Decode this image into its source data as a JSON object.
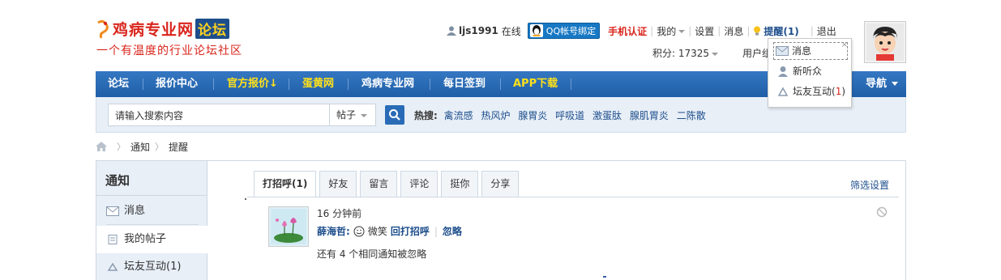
{
  "logo": {
    "title": "鸡病专业网",
    "badge": "论坛",
    "slogan": "一个有温度的行业论坛社区"
  },
  "topbar": {
    "username": "ljs1991",
    "online": "在线",
    "qq_bind": "QQ帐号绑定",
    "phone_verify": "手机认证",
    "mine": "我的",
    "settings": "设置",
    "messages": "消息",
    "remind": "提醒(1)",
    "logout": "退出",
    "points": "积分: 17325",
    "usergroup": "用户组"
  },
  "nav": {
    "items": [
      {
        "label": "论坛",
        "highlight": false
      },
      {
        "label": "报价中心",
        "highlight": false
      },
      {
        "label": "官方报价↓",
        "highlight": true
      },
      {
        "label": "蛋黄网",
        "highlight": true
      },
      {
        "label": "鸡病专业网",
        "highlight": false
      },
      {
        "label": "每日签到",
        "highlight": false
      },
      {
        "label": "APP下载",
        "highlight": true
      }
    ],
    "right_label": "导航"
  },
  "search": {
    "placeholder": "请输入搜索内容",
    "type": "帖子",
    "hot_label": "热搜:",
    "hot": [
      "禽流感",
      "热风炉",
      "腺胃炎",
      "呼吸道",
      "激蛋肽",
      "腺肌胃炎",
      "二陈散"
    ]
  },
  "breadcrumb": {
    "items": [
      "通知",
      "提醒"
    ]
  },
  "sidebar": {
    "title": "通知",
    "items": [
      {
        "label": "消息",
        "icon": "mail-icon"
      },
      {
        "label": "我的帖子",
        "icon": "document-icon"
      },
      {
        "label": "坛友互动(1)",
        "icon": "recycle-icon"
      }
    ]
  },
  "tabs": {
    "items": [
      "打招呼(1)",
      "好友",
      "留言",
      "评论",
      "挺你",
      "分享"
    ],
    "active": 0,
    "filter": "筛选设置"
  },
  "notice": {
    "time": "16 分钟前",
    "user": "薛海哲:",
    "action_text": "微笑",
    "reply": "回打招呼",
    "ignore": "忽略",
    "ignored_note": "还有 4 个相同通知被忽略"
  },
  "popup": {
    "items": [
      {
        "label": "消息",
        "icon": "mail-icon"
      },
      {
        "label": "新听众",
        "icon": "user-icon"
      },
      {
        "label_prefix": "坛友互动(",
        "count": "1",
        "label_suffix": ")",
        "icon": "recycle-icon"
      }
    ],
    "close": "×"
  },
  "colors": {
    "brand_red": "#d9251c",
    "nav_blue": "#2a6bb7",
    "link_blue": "#1d4e8c",
    "nav_yellow": "#ffe11a"
  }
}
